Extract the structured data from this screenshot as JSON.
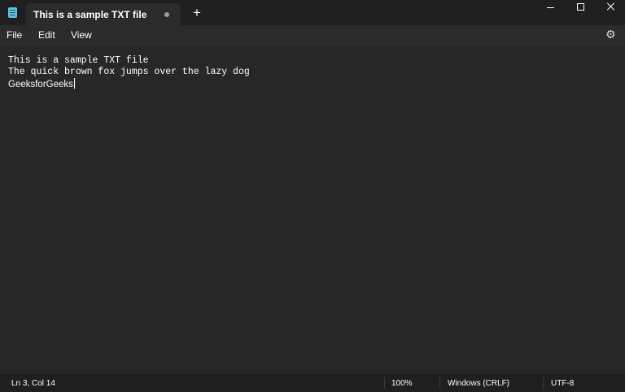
{
  "tab": {
    "title": "This is a sample TXT file",
    "unsaved_indicator": "dot-icon"
  },
  "new_tab": {
    "label": "+"
  },
  "window_controls": {
    "minimize": "minimize-icon",
    "maximize": "maximize-icon",
    "close": "close-icon"
  },
  "menu": {
    "file": "File",
    "edit": "Edit",
    "view": "View",
    "settings_icon": "gear-icon"
  },
  "editor": {
    "lines": [
      "This is a sample TXT file",
      "The quick brown fox jumps over the lazy dog",
      "GeeksforGeeks"
    ]
  },
  "status": {
    "position": "Ln 3, Col 14",
    "zoom": "100%",
    "line_ending": "Windows (CRLF)",
    "encoding": "UTF-8"
  },
  "colors": {
    "window_bg": "#272727",
    "titlebar_bg": "#1f1f1f",
    "tab_bg": "#2b2b2b",
    "app_icon": "#5ec3d9",
    "text": "#ffffff"
  }
}
